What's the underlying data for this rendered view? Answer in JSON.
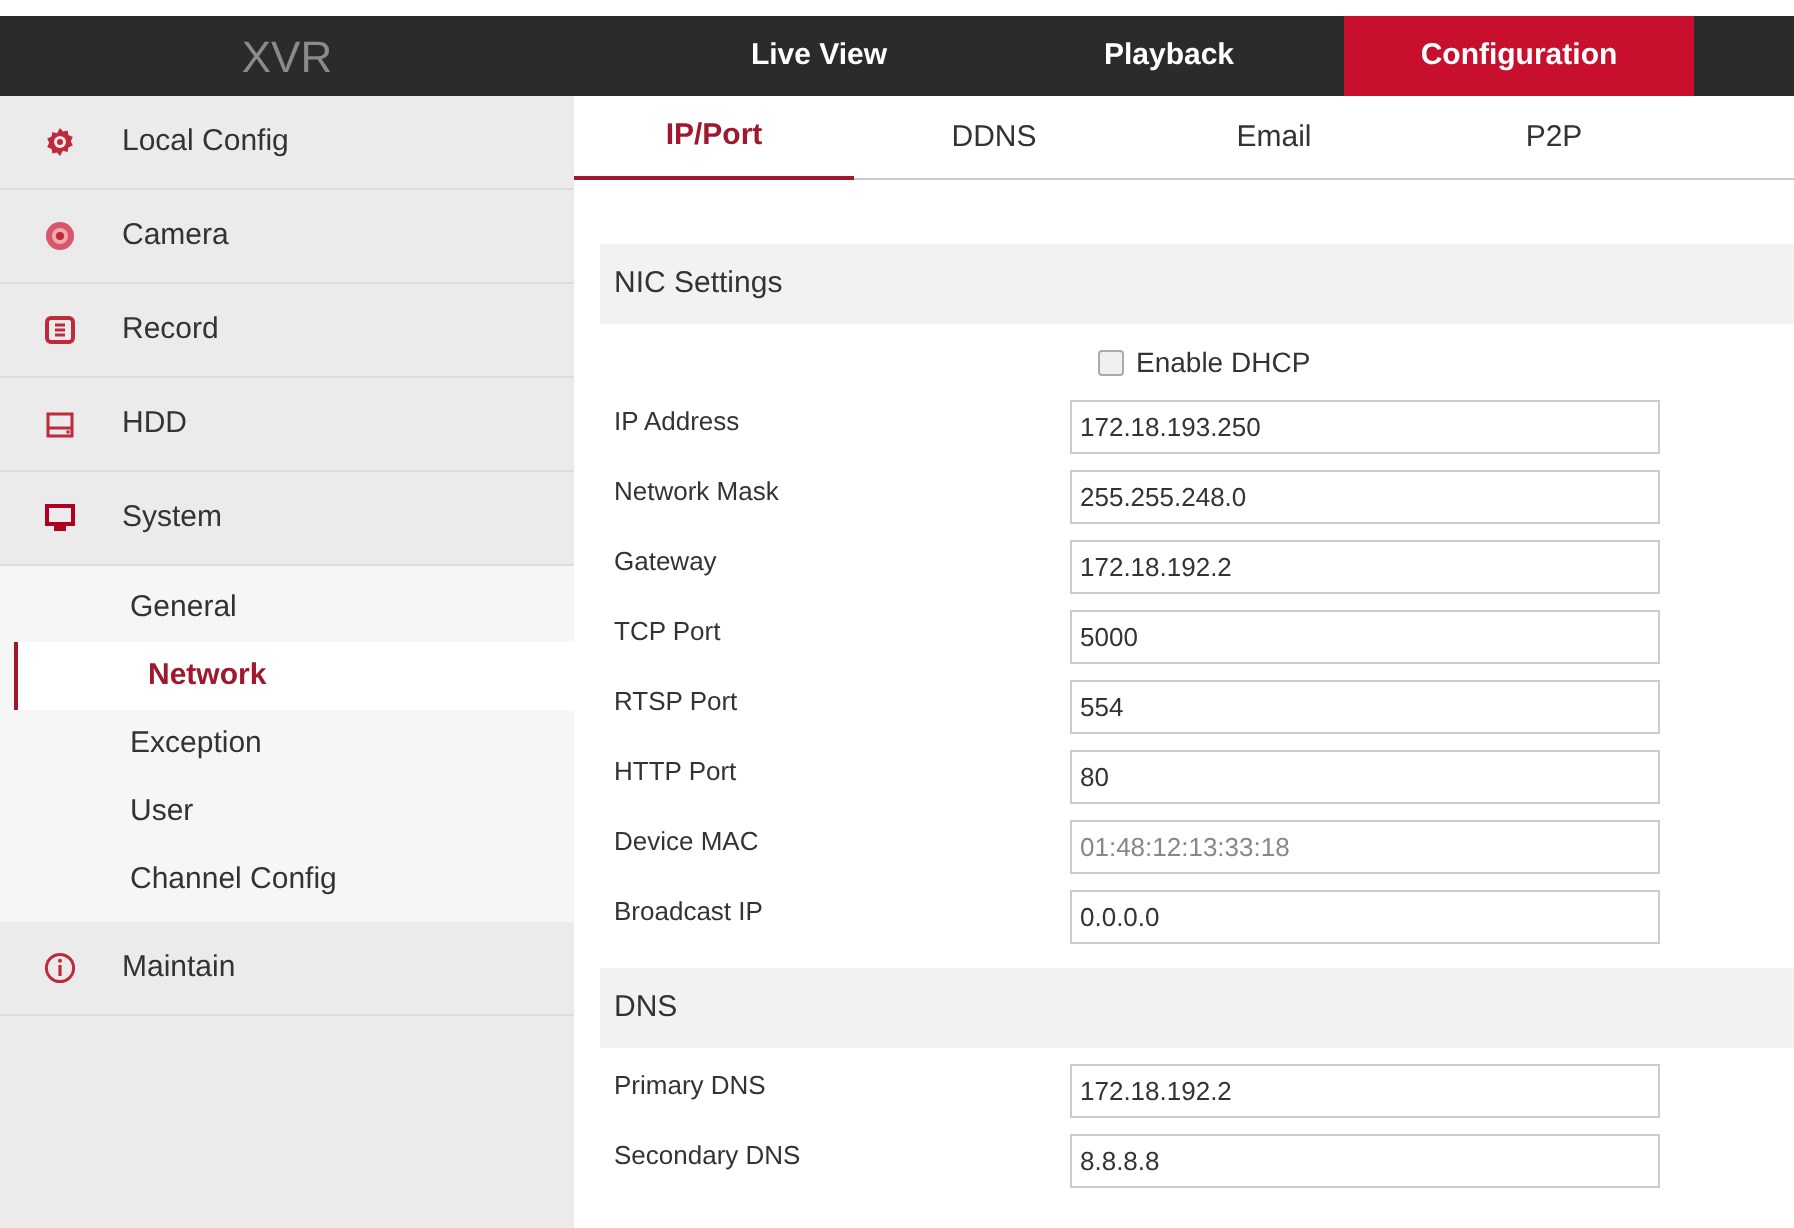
{
  "header": {
    "logo": "XVR",
    "nav": [
      {
        "label": "Live View",
        "selected": false
      },
      {
        "label": "Playback",
        "selected": false
      },
      {
        "label": "Configuration",
        "selected": true
      }
    ]
  },
  "sidebar": {
    "items": [
      {
        "label": "Local Config",
        "kind": "gear",
        "selected": false
      },
      {
        "label": "Camera",
        "kind": "camera",
        "selected": false
      },
      {
        "label": "Record",
        "kind": "record",
        "selected": false
      },
      {
        "label": "HDD",
        "kind": "hdd",
        "selected": false
      },
      {
        "label": "System",
        "kind": "monitor",
        "expanded": true,
        "children": [
          {
            "label": "General",
            "selected": false
          },
          {
            "label": "Network",
            "selected": true
          },
          {
            "label": "Exception",
            "selected": false
          },
          {
            "label": "User",
            "selected": false
          },
          {
            "label": "Channel Config",
            "selected": false
          }
        ]
      },
      {
        "label": "Maintain",
        "kind": "info",
        "selected": false
      }
    ]
  },
  "tabs": [
    {
      "label": "IP/Port",
      "selected": true
    },
    {
      "label": "DDNS",
      "selected": false
    },
    {
      "label": "Email",
      "selected": false
    },
    {
      "label": "P2P",
      "selected": false
    }
  ],
  "sections": [
    {
      "title": "NIC Settings",
      "checkbox": {
        "label": "Enable DHCP",
        "checked": false
      },
      "fields": [
        {
          "label": "IP Address",
          "value": "172.18.193.250",
          "disabled": false
        },
        {
          "label": "Network Mask",
          "value": "255.255.248.0",
          "disabled": false
        },
        {
          "label": "Gateway",
          "value": "172.18.192.2",
          "disabled": false
        },
        {
          "label": "TCP Port",
          "value": "5000",
          "disabled": false
        },
        {
          "label": "RTSP Port",
          "value": "554",
          "disabled": false
        },
        {
          "label": "HTTP Port",
          "value": "80",
          "disabled": false
        },
        {
          "label": "Device MAC",
          "value": "01:48:12:13:33:18",
          "disabled": true
        },
        {
          "label": "Broadcast IP",
          "value": "0.0.0.0",
          "disabled": false
        }
      ]
    },
    {
      "title": "DNS",
      "fields": [
        {
          "label": "Primary DNS",
          "value": "172.18.192.2",
          "disabled": false
        },
        {
          "label": "Secondary DNS",
          "value": "8.8.8.8",
          "disabled": false
        }
      ]
    }
  ]
}
